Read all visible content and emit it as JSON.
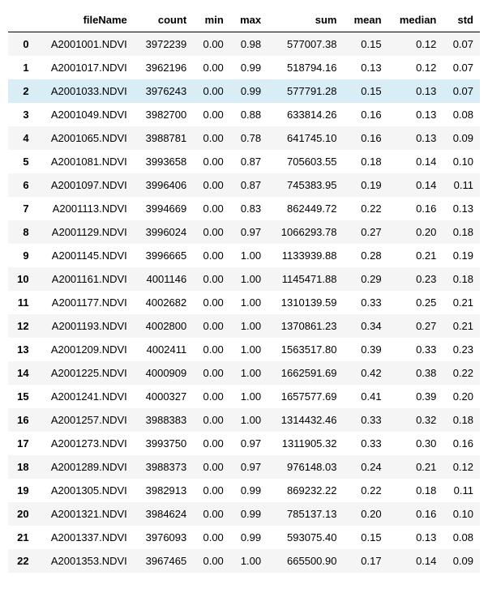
{
  "highlight_index": 2,
  "columns": [
    "fileName",
    "count",
    "min",
    "max",
    "sum",
    "mean",
    "median",
    "std"
  ],
  "rows": [
    {
      "idx": "0",
      "fileName": "A2001001.NDVI",
      "count": "3972239",
      "min": "0.00",
      "max": "0.98",
      "sum": "577007.38",
      "mean": "0.15",
      "median": "0.12",
      "std": "0.07"
    },
    {
      "idx": "1",
      "fileName": "A2001017.NDVI",
      "count": "3962196",
      "min": "0.00",
      "max": "0.99",
      "sum": "518794.16",
      "mean": "0.13",
      "median": "0.12",
      "std": "0.07"
    },
    {
      "idx": "2",
      "fileName": "A2001033.NDVI",
      "count": "3976243",
      "min": "0.00",
      "max": "0.99",
      "sum": "577791.28",
      "mean": "0.15",
      "median": "0.13",
      "std": "0.07"
    },
    {
      "idx": "3",
      "fileName": "A2001049.NDVI",
      "count": "3982700",
      "min": "0.00",
      "max": "0.88",
      "sum": "633814.26",
      "mean": "0.16",
      "median": "0.13",
      "std": "0.08"
    },
    {
      "idx": "4",
      "fileName": "A2001065.NDVI",
      "count": "3988781",
      "min": "0.00",
      "max": "0.78",
      "sum": "641745.10",
      "mean": "0.16",
      "median": "0.13",
      "std": "0.09"
    },
    {
      "idx": "5",
      "fileName": "A2001081.NDVI",
      "count": "3993658",
      "min": "0.00",
      "max": "0.87",
      "sum": "705603.55",
      "mean": "0.18",
      "median": "0.14",
      "std": "0.10"
    },
    {
      "idx": "6",
      "fileName": "A2001097.NDVI",
      "count": "3996406",
      "min": "0.00",
      "max": "0.87",
      "sum": "745383.95",
      "mean": "0.19",
      "median": "0.14",
      "std": "0.11"
    },
    {
      "idx": "7",
      "fileName": "A2001113.NDVI",
      "count": "3994669",
      "min": "0.00",
      "max": "0.83",
      "sum": "862449.72",
      "mean": "0.22",
      "median": "0.16",
      "std": "0.13"
    },
    {
      "idx": "8",
      "fileName": "A2001129.NDVI",
      "count": "3996024",
      "min": "0.00",
      "max": "0.97",
      "sum": "1066293.78",
      "mean": "0.27",
      "median": "0.20",
      "std": "0.18"
    },
    {
      "idx": "9",
      "fileName": "A2001145.NDVI",
      "count": "3996665",
      "min": "0.00",
      "max": "1.00",
      "sum": "1133939.88",
      "mean": "0.28",
      "median": "0.21",
      "std": "0.19"
    },
    {
      "idx": "10",
      "fileName": "A2001161.NDVI",
      "count": "4001146",
      "min": "0.00",
      "max": "1.00",
      "sum": "1145471.88",
      "mean": "0.29",
      "median": "0.23",
      "std": "0.18"
    },
    {
      "idx": "11",
      "fileName": "A2001177.NDVI",
      "count": "4002682",
      "min": "0.00",
      "max": "1.00",
      "sum": "1310139.59",
      "mean": "0.33",
      "median": "0.25",
      "std": "0.21"
    },
    {
      "idx": "12",
      "fileName": "A2001193.NDVI",
      "count": "4002800",
      "min": "0.00",
      "max": "1.00",
      "sum": "1370861.23",
      "mean": "0.34",
      "median": "0.27",
      "std": "0.21"
    },
    {
      "idx": "13",
      "fileName": "A2001209.NDVI",
      "count": "4002411",
      "min": "0.00",
      "max": "1.00",
      "sum": "1563517.80",
      "mean": "0.39",
      "median": "0.33",
      "std": "0.23"
    },
    {
      "idx": "14",
      "fileName": "A2001225.NDVI",
      "count": "4000909",
      "min": "0.00",
      "max": "1.00",
      "sum": "1662591.69",
      "mean": "0.42",
      "median": "0.38",
      "std": "0.22"
    },
    {
      "idx": "15",
      "fileName": "A2001241.NDVI",
      "count": "4000327",
      "min": "0.00",
      "max": "1.00",
      "sum": "1657577.69",
      "mean": "0.41",
      "median": "0.39",
      "std": "0.20"
    },
    {
      "idx": "16",
      "fileName": "A2001257.NDVI",
      "count": "3988383",
      "min": "0.00",
      "max": "1.00",
      "sum": "1314432.46",
      "mean": "0.33",
      "median": "0.32",
      "std": "0.18"
    },
    {
      "idx": "17",
      "fileName": "A2001273.NDVI",
      "count": "3993750",
      "min": "0.00",
      "max": "0.97",
      "sum": "1311905.32",
      "mean": "0.33",
      "median": "0.30",
      "std": "0.16"
    },
    {
      "idx": "18",
      "fileName": "A2001289.NDVI",
      "count": "3988373",
      "min": "0.00",
      "max": "0.97",
      "sum": "976148.03",
      "mean": "0.24",
      "median": "0.21",
      "std": "0.12"
    },
    {
      "idx": "19",
      "fileName": "A2001305.NDVI",
      "count": "3982913",
      "min": "0.00",
      "max": "0.99",
      "sum": "869232.22",
      "mean": "0.22",
      "median": "0.18",
      "std": "0.11"
    },
    {
      "idx": "20",
      "fileName": "A2001321.NDVI",
      "count": "3984624",
      "min": "0.00",
      "max": "0.99",
      "sum": "785137.13",
      "mean": "0.20",
      "median": "0.16",
      "std": "0.10"
    },
    {
      "idx": "21",
      "fileName": "A2001337.NDVI",
      "count": "3976093",
      "min": "0.00",
      "max": "0.99",
      "sum": "593075.40",
      "mean": "0.15",
      "median": "0.13",
      "std": "0.08"
    },
    {
      "idx": "22",
      "fileName": "A2001353.NDVI",
      "count": "3967465",
      "min": "0.00",
      "max": "1.00",
      "sum": "665500.90",
      "mean": "0.17",
      "median": "0.14",
      "std": "0.09"
    }
  ]
}
